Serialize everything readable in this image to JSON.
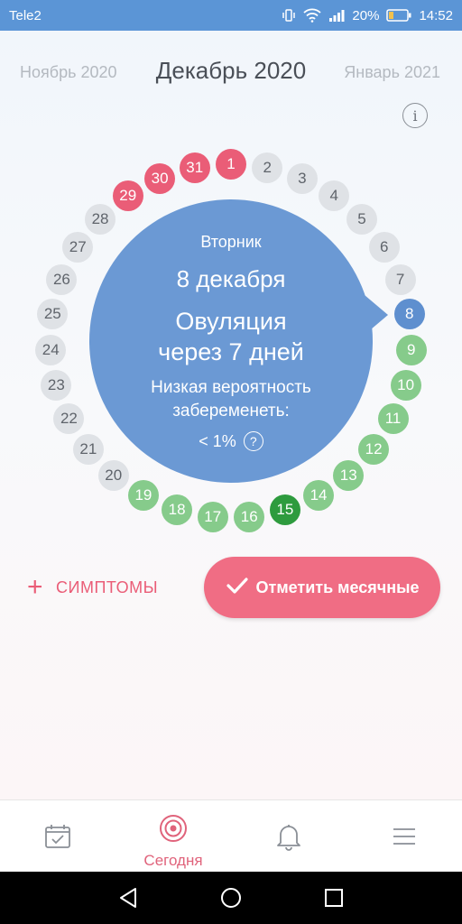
{
  "status_bar": {
    "carrier": "Tele2",
    "battery": "20%",
    "time": "14:52"
  },
  "header": {
    "prev_month": "Ноябрь 2020",
    "current_month": "Декабрь 2020",
    "next_month": "Январь 2021",
    "info_glyph": "i"
  },
  "days": [
    {
      "label": "1",
      "type": "period"
    },
    {
      "label": "2",
      "type": "past"
    },
    {
      "label": "3",
      "type": "past"
    },
    {
      "label": "4",
      "type": "past"
    },
    {
      "label": "5",
      "type": "past"
    },
    {
      "label": "6",
      "type": "past"
    },
    {
      "label": "7",
      "type": "past"
    },
    {
      "label": "8",
      "type": "today"
    },
    {
      "label": "9",
      "type": "fertile"
    },
    {
      "label": "10",
      "type": "fertile"
    },
    {
      "label": "11",
      "type": "fertile"
    },
    {
      "label": "12",
      "type": "fertile"
    },
    {
      "label": "13",
      "type": "fertile"
    },
    {
      "label": "14",
      "type": "fertile"
    },
    {
      "label": "15",
      "type": "ovul"
    },
    {
      "label": "16",
      "type": "fertile"
    },
    {
      "label": "17",
      "type": "fertile"
    },
    {
      "label": "18",
      "type": "fertile"
    },
    {
      "label": "19",
      "type": "fertile"
    },
    {
      "label": "20",
      "type": "past"
    },
    {
      "label": "21",
      "type": "past"
    },
    {
      "label": "22",
      "type": "past"
    },
    {
      "label": "23",
      "type": "past"
    },
    {
      "label": "24",
      "type": "past"
    },
    {
      "label": "25",
      "type": "past"
    },
    {
      "label": "26",
      "type": "past"
    },
    {
      "label": "27",
      "type": "past"
    },
    {
      "label": "28",
      "type": "past"
    },
    {
      "label": "29",
      "type": "period"
    },
    {
      "label": "30",
      "type": "period"
    },
    {
      "label": "31",
      "type": "period"
    }
  ],
  "bubble": {
    "weekday": "Вторник",
    "date": "8 декабря",
    "ovulation_line1": "Овуляция",
    "ovulation_line2": "через 7 дней",
    "probability_line1": "Низкая вероятность",
    "probability_line2": "забеременеть:",
    "probability_value": "< 1%",
    "help_glyph": "?"
  },
  "actions": {
    "symptoms_label": "СИМПТОМЫ",
    "mark_period_label": "Отметить месячные"
  },
  "bottom_nav": {
    "today_label": "Сегодня"
  },
  "colors": {
    "status_bar": "#5b95d6",
    "period": "#ea5d77",
    "fertile": "#86cb8b",
    "ovulation": "#2e9b3e",
    "today": "#5e8fcf",
    "bubble": "#6b99d4",
    "accent_pink": "#f06d84"
  }
}
